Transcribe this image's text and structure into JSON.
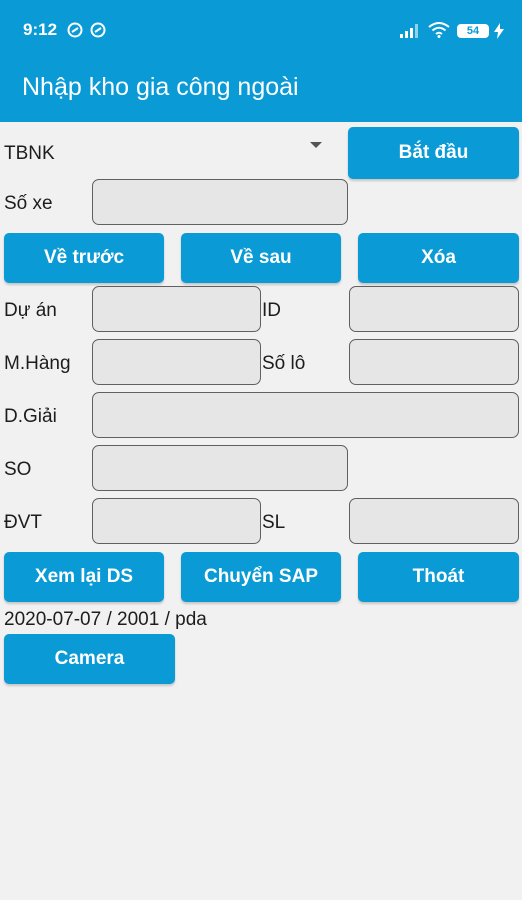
{
  "status_bar": {
    "time": "9:12",
    "battery": "54"
  },
  "app_bar": {
    "title": "Nhập kho gia công ngoài"
  },
  "form": {
    "warehouse_value": "TBNK",
    "start_label": "Bắt đầu",
    "vehicle_label": "Số xe",
    "prev_label": "Về trước",
    "next_label": "Về sau",
    "delete_label": "Xóa",
    "project_label": "Dự án",
    "id_label": "ID",
    "item_code_label": "M.Hàng",
    "lot_label": "Số lô",
    "description_label": "D.Giải",
    "so_label": "SO",
    "unit_label": "ĐVT",
    "qty_label": "SL",
    "review_label": "Xem lại DS",
    "transfer_label": "Chuyển SAP",
    "exit_label": "Thoát",
    "info_text": "2020-07-07 / 2001 / pda",
    "camera_label": "Camera"
  },
  "colors": {
    "primary": "#0a9bd6",
    "background": "#f1f1f1",
    "field": "#e6e6e6"
  },
  "icons": [
    "nfc-icon",
    "nfc-icon",
    "signal-icon",
    "wifi-icon",
    "battery-icon",
    "charging-icon",
    "dropdown-arrow-icon"
  ]
}
